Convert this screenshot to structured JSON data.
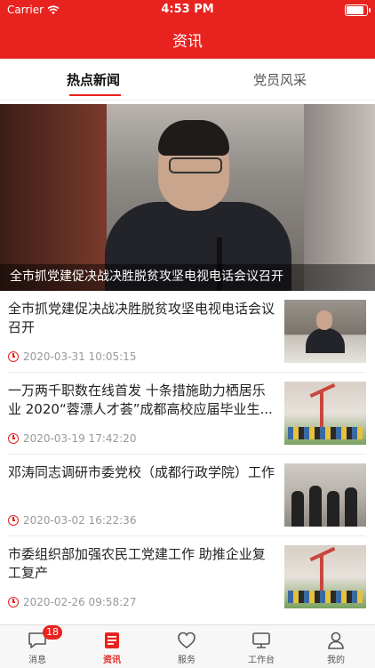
{
  "status_bar": {
    "carrier": "Carrier",
    "time": "4:53 PM",
    "battery_level": 0.95
  },
  "header": {
    "title": "资讯"
  },
  "tabs": [
    {
      "label": "热点新闻",
      "active": true
    },
    {
      "label": "党员风采",
      "active": false
    }
  ],
  "banner": {
    "caption": "全市抓党建促决战决胜脱贫攻坚电视电话会议召开"
  },
  "news": [
    {
      "title": "全市抓党建促决战决胜脱贫攻坚电视电话会议召开",
      "date": "2020-03-31 10:05:15"
    },
    {
      "title": "一万两千职数在线首发 十条措施助力栖居乐业 2020“蓉漂人才荟”成都高校应届毕业生...",
      "date": "2020-03-19 17:42:20"
    },
    {
      "title": "邓涛同志调研市委党校（成都行政学院）工作",
      "date": "2020-03-02 16:22:36"
    },
    {
      "title": "市委组织部加强农民工党建工作 助推企业复工复产",
      "date": "2020-02-26 09:58:27"
    }
  ],
  "tabbar": [
    {
      "label": "消息",
      "icon": "message-icon",
      "badge": "18"
    },
    {
      "label": "资讯",
      "icon": "news-icon",
      "active": true
    },
    {
      "label": "服务",
      "icon": "heart-icon"
    },
    {
      "label": "工作台",
      "icon": "monitor-icon"
    },
    {
      "label": "我的",
      "icon": "user-icon"
    }
  ],
  "colors": {
    "brand": "#e8231f",
    "text": "#222222",
    "muted": "#999999"
  }
}
